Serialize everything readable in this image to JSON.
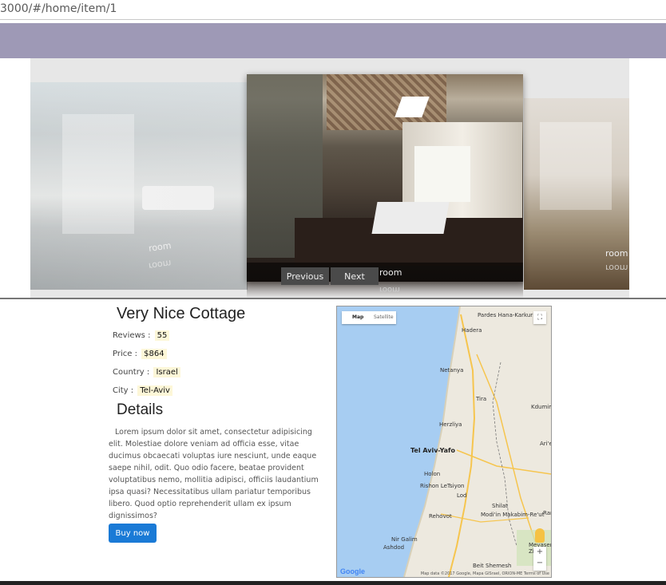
{
  "browser": {
    "url": "3000/#/home/item/1"
  },
  "carousel": {
    "previous_label": "Previous",
    "next_label": "Next",
    "slide_caption": "room"
  },
  "item": {
    "title": "Very Nice Cottage",
    "fields": [
      {
        "label": "Reviews :",
        "value": "55"
      },
      {
        "label": "Price :",
        "value": "$864"
      },
      {
        "label": "Country :",
        "value": "Israel"
      },
      {
        "label": "City :",
        "value": "Tel-Aviv"
      }
    ],
    "details_heading": "Details",
    "description": "Lorem ipsum dolor sit amet, consectetur adipisicing elit. Molestiae dolore veniam ad officia esse, vitae ducimus obcaecati voluptas iure nesciunt, unde eaque saepe nihil, odit. Quo odio facere, beatae provident voluptatibus nemo, mollitia adipisci, officiis laudantium ipsa quasi? Necessitatibus ullam pariatur temporibus libero. Quod optio reprehenderit ullam ex ipsum dignissimos?",
    "buy_label": "Buy now"
  },
  "map": {
    "type_options": [
      "Map",
      "Satellite"
    ],
    "cities": [
      "Pardes Hana-Karkur",
      "Hadera",
      "Netanya",
      "Tira",
      "Kdumim",
      "Herzliya",
      "Tel Aviv-Yafo",
      "Holon",
      "Rishon LeTsiyon",
      "Lod",
      "Shilat",
      "Rehovot",
      "Modi'in Makabim-Re'ut",
      "Nir Galim",
      "Ashdod",
      "Beit Shemesh",
      "Mevaseret Zion",
      "Ari'el",
      "Ram"
    ],
    "google_logo": "Google",
    "attribution": "Map data ©2017 Google, Mapa GISrael, ORION-ME   Terms of Use",
    "zoom_in": "+",
    "zoom_out": "−",
    "fullscreen_icon": "⛶"
  },
  "colors": {
    "header_band": "#9e99b6",
    "buy_button": "#1a7ad6",
    "value_highlight": "#fdf7d8",
    "sea": "#a7cdf2"
  }
}
